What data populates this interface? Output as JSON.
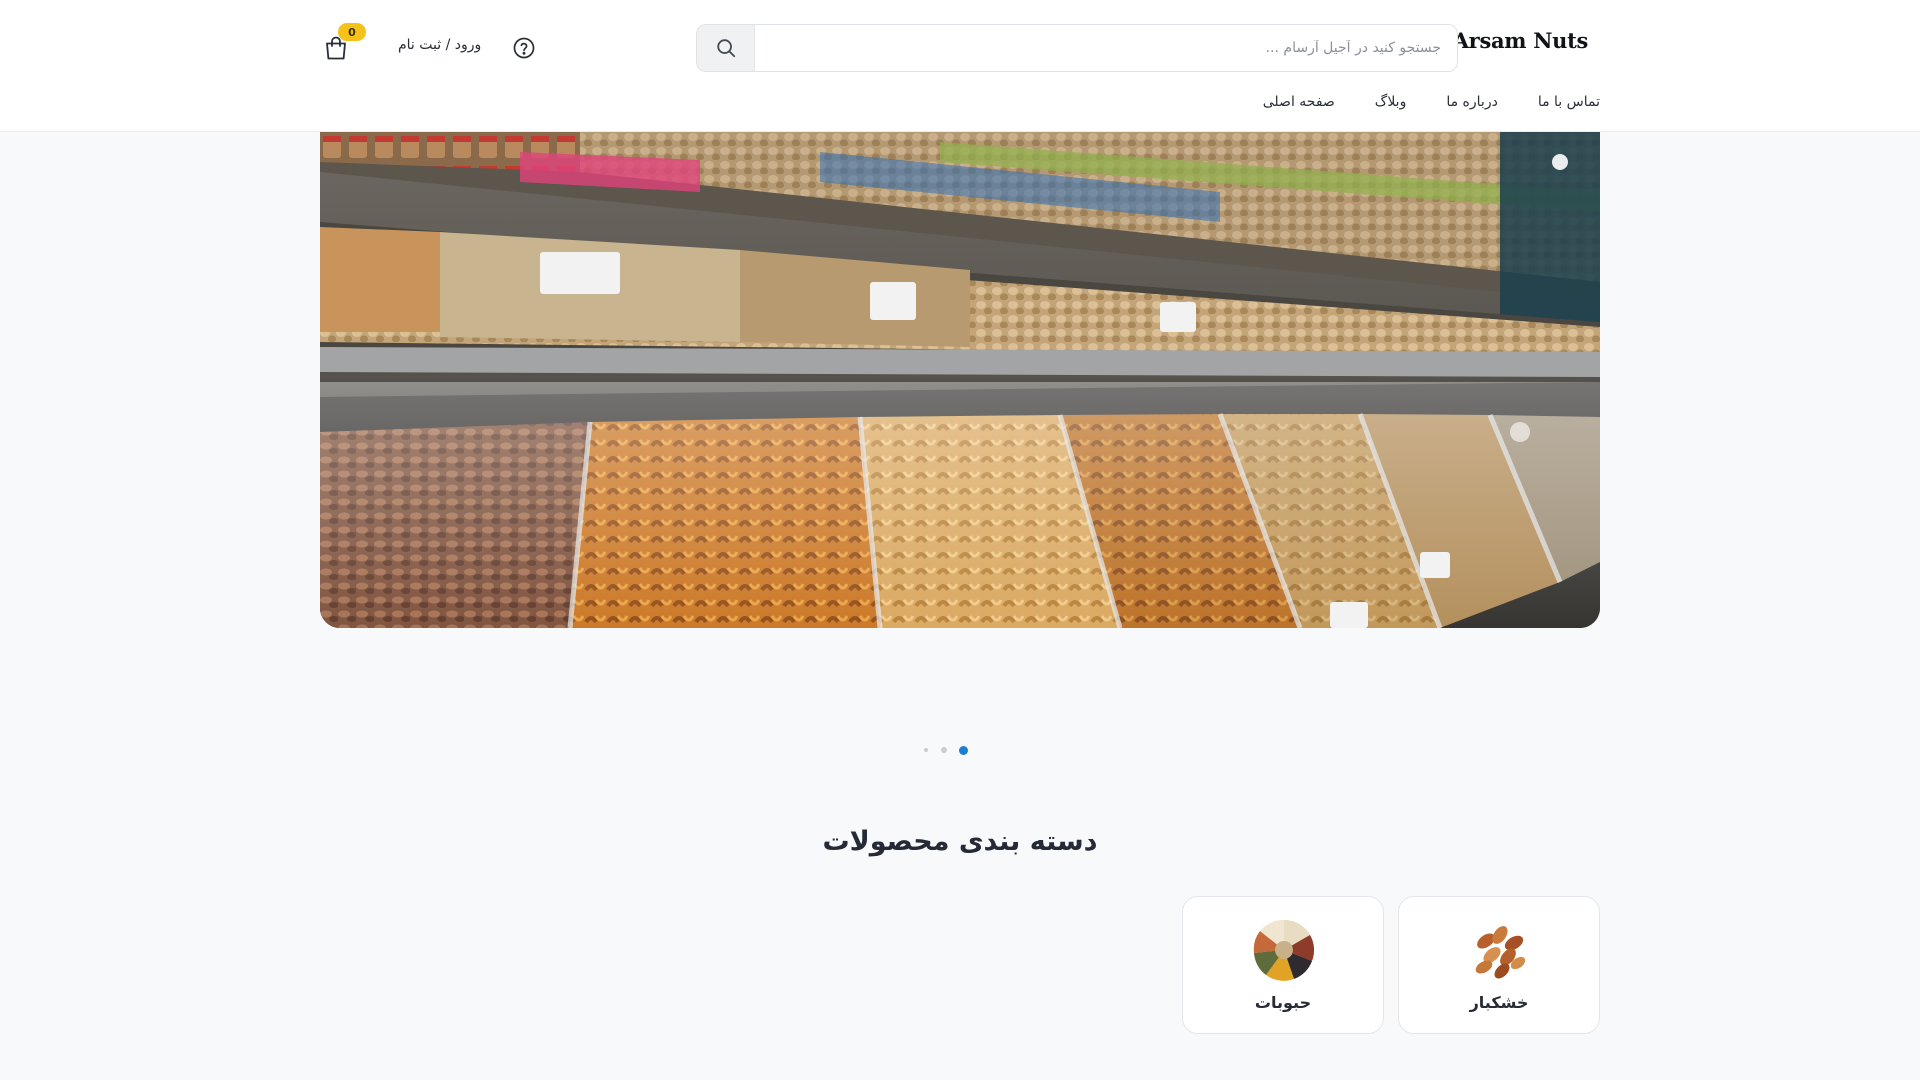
{
  "header": {
    "logo": "Arsam Nuts",
    "search": {
      "placeholder": "جستجو کنید در آجیل آرسام ...",
      "value": ""
    },
    "login_label": "ورود / ثبت نام",
    "cart_count": "0",
    "nav": [
      {
        "label": "صفحه اصلی"
      },
      {
        "label": "وبلاگ"
      },
      {
        "label": "درباره ما"
      },
      {
        "label": "تماس با ما"
      }
    ]
  },
  "slider": {
    "slide_count": 3,
    "active_slide": 1
  },
  "categories": {
    "title": "دسته بندی محصولات",
    "items": [
      {
        "label": "خشکبار",
        "icon": "nuts-thumbnail"
      },
      {
        "label": "حبوبات",
        "icon": "legumes-thumbnail"
      }
    ]
  },
  "colors": {
    "accent": "#1a7ed6",
    "badge": "#f5c21a",
    "background": "#f8f9fb"
  }
}
